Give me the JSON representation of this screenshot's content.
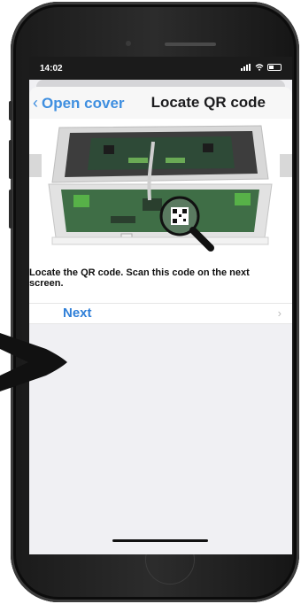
{
  "status_bar": {
    "time": "14:02"
  },
  "nav": {
    "back_label": "Open cover",
    "back_icon": "chevron-left-icon",
    "title": "Locate QR code"
  },
  "instruction": {
    "text": "Locate the QR code. Scan this code on the next screen."
  },
  "next_row": {
    "label": "Next",
    "chevron": "chevron-right-icon"
  },
  "colors": {
    "accent": "#2f7fd8",
    "background": "#f0f0f3",
    "phone_frame": "#1a1a1a"
  }
}
